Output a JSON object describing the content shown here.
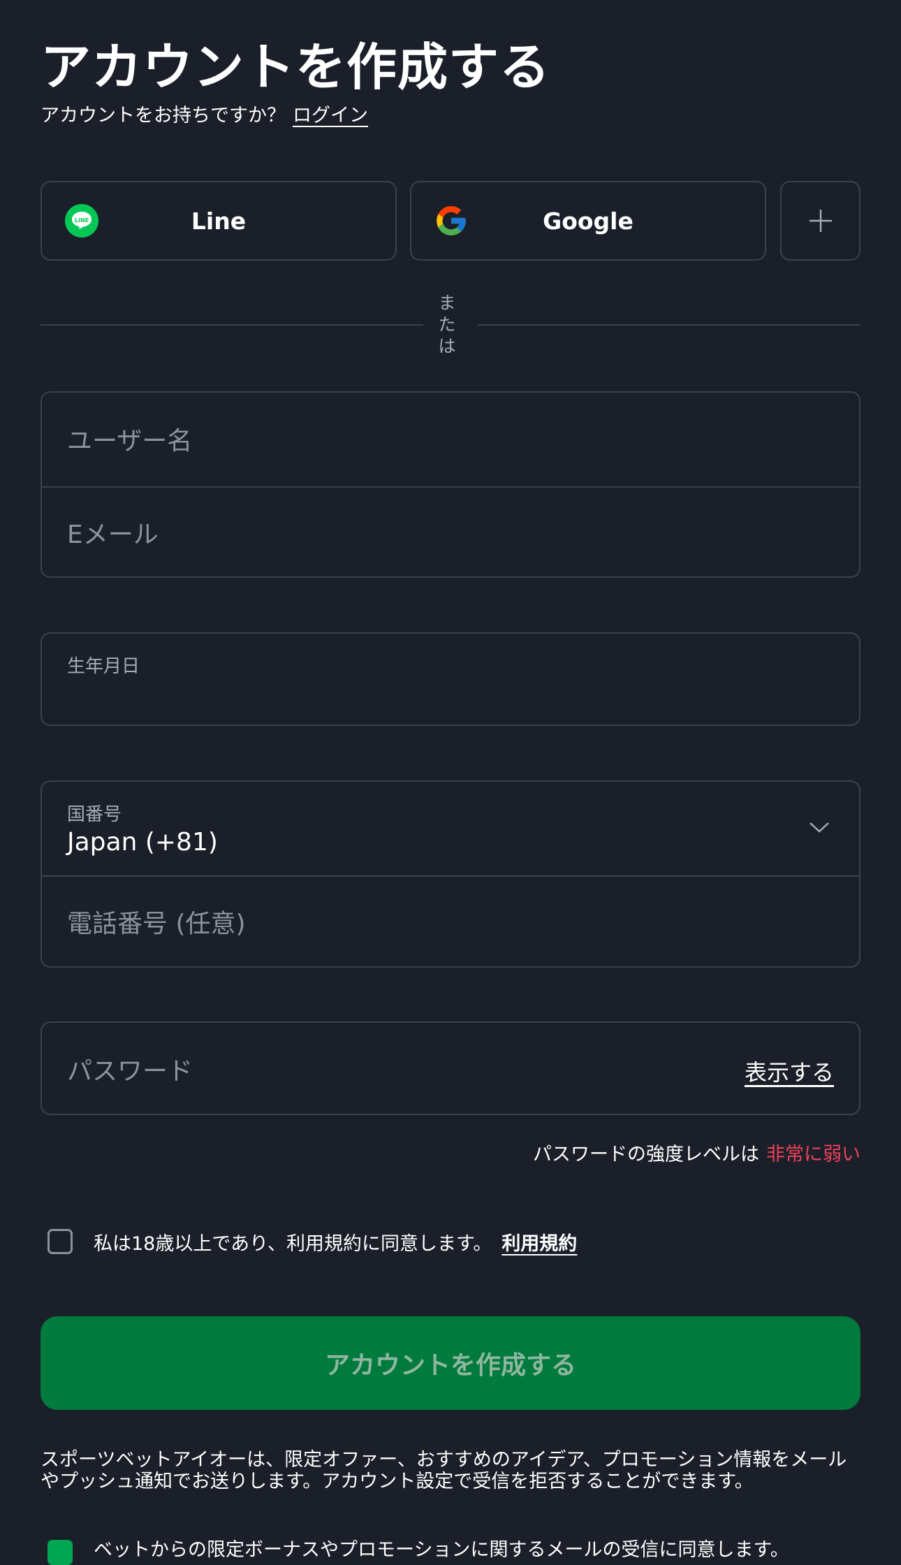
{
  "page": {
    "title": "アカウントを作成する",
    "have_account": "アカウントをお持ちですか？",
    "login_link": "ログイン"
  },
  "social": {
    "line_label": "Line",
    "google_label": "Google",
    "more_icon": "plus-icon"
  },
  "divider": {
    "or_char_1": "ま",
    "or_char_2": "た",
    "or_char_3": "は"
  },
  "form": {
    "username_placeholder": "ユーザー名",
    "email_placeholder": "Eメール",
    "birthdate_label": "生年月日",
    "country_code_label": "国番号",
    "country_code_value": "Japan (+81)",
    "phone_placeholder": "電話番号 (任意)",
    "password_placeholder": "パスワード",
    "show_password": "表示する"
  },
  "password_strength": {
    "label": "パスワードの強度レベルは",
    "value": "非常に弱い"
  },
  "terms": {
    "text": "私は18歳以上であり、利用規約に同意します。",
    "link": "利用規約"
  },
  "submit_label": "アカウントを作成する",
  "info_text": "スポーツベットアイオーは、限定オファー、おすすめのアイデア、プロモーション情報をメールやプッシュ通知でお送りします。アカウント設定で受信を拒否することができます。",
  "consent_text": "ベットからの限定ボーナスやプロモーションに関するメールの受信に同意します。",
  "colors": {
    "background": "#1a1f29",
    "border": "#3b424e",
    "cta": "#007a3d",
    "weak": "#f0405a",
    "line_green": "#06c755"
  }
}
